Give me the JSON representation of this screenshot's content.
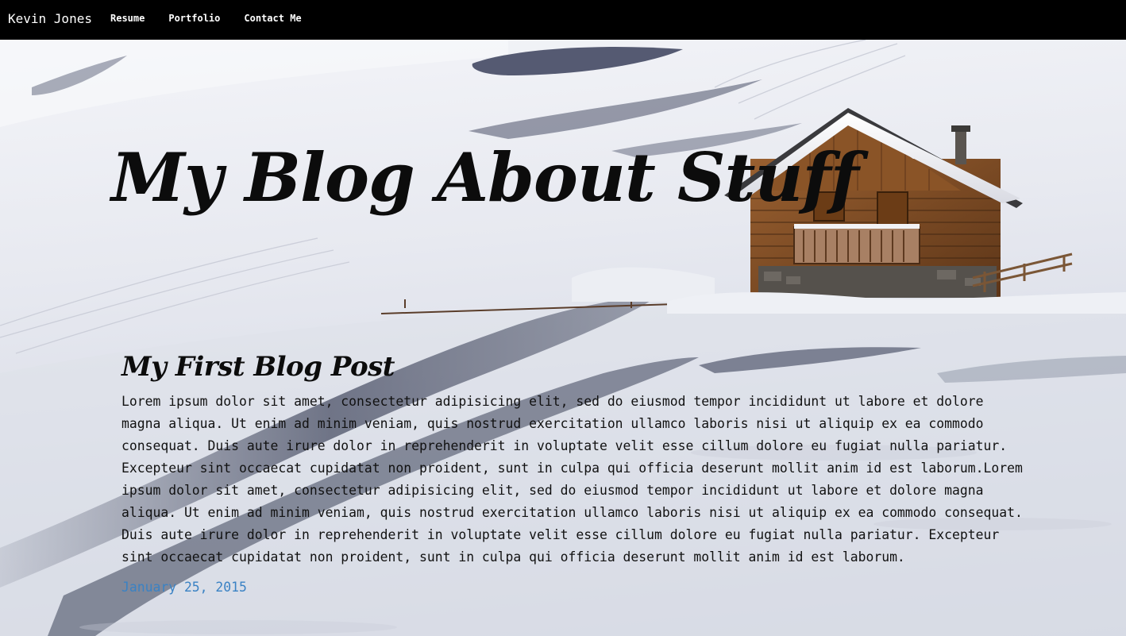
{
  "nav": {
    "brand": "Kevin Jones",
    "links": [
      "Resume",
      "Portfolio",
      "Contact Me"
    ]
  },
  "hero": {
    "title": "My Blog About Stuff"
  },
  "post": {
    "title": "My First Blog Post",
    "body": "Lorem ipsum dolor sit amet, consectetur adipisicing elit, sed do eiusmod tempor incididunt ut labore et dolore magna aliqua. Ut enim ad minim veniam, quis nostrud exercitation ullamco laboris nisi ut aliquip ex ea commodo consequat. Duis aute irure dolor in reprehenderit in voluptate velit esse cillum dolore eu fugiat nulla pariatur. Excepteur sint occaecat cupidatat non proident, sunt in culpa qui officia deserunt mollit anim id est laborum.Lorem ipsum dolor sit amet, consectetur adipisicing elit, sed do eiusmod tempor incididunt ut labore et dolore magna aliqua. Ut enim ad minim veniam, quis nostrud exercitation ullamco laboris nisi ut aliquip ex ea commodo consequat. Duis aute irure dolor in reprehenderit in voluptate velit esse cillum dolore eu fugiat nulla pariatur. Excepteur sint occaecat cupidatat non proident, sunt in culpa qui officia deserunt mollit anim id est laborum.",
    "date": "January 25, 2015"
  },
  "colors": {
    "navbar": "#000000",
    "date_link": "#3a82c4",
    "snow": "#e9ecf2",
    "shadow": "#3b4158",
    "cabin_wood": "#7a4a24"
  },
  "background_image": "snowy-mountain-cabin"
}
